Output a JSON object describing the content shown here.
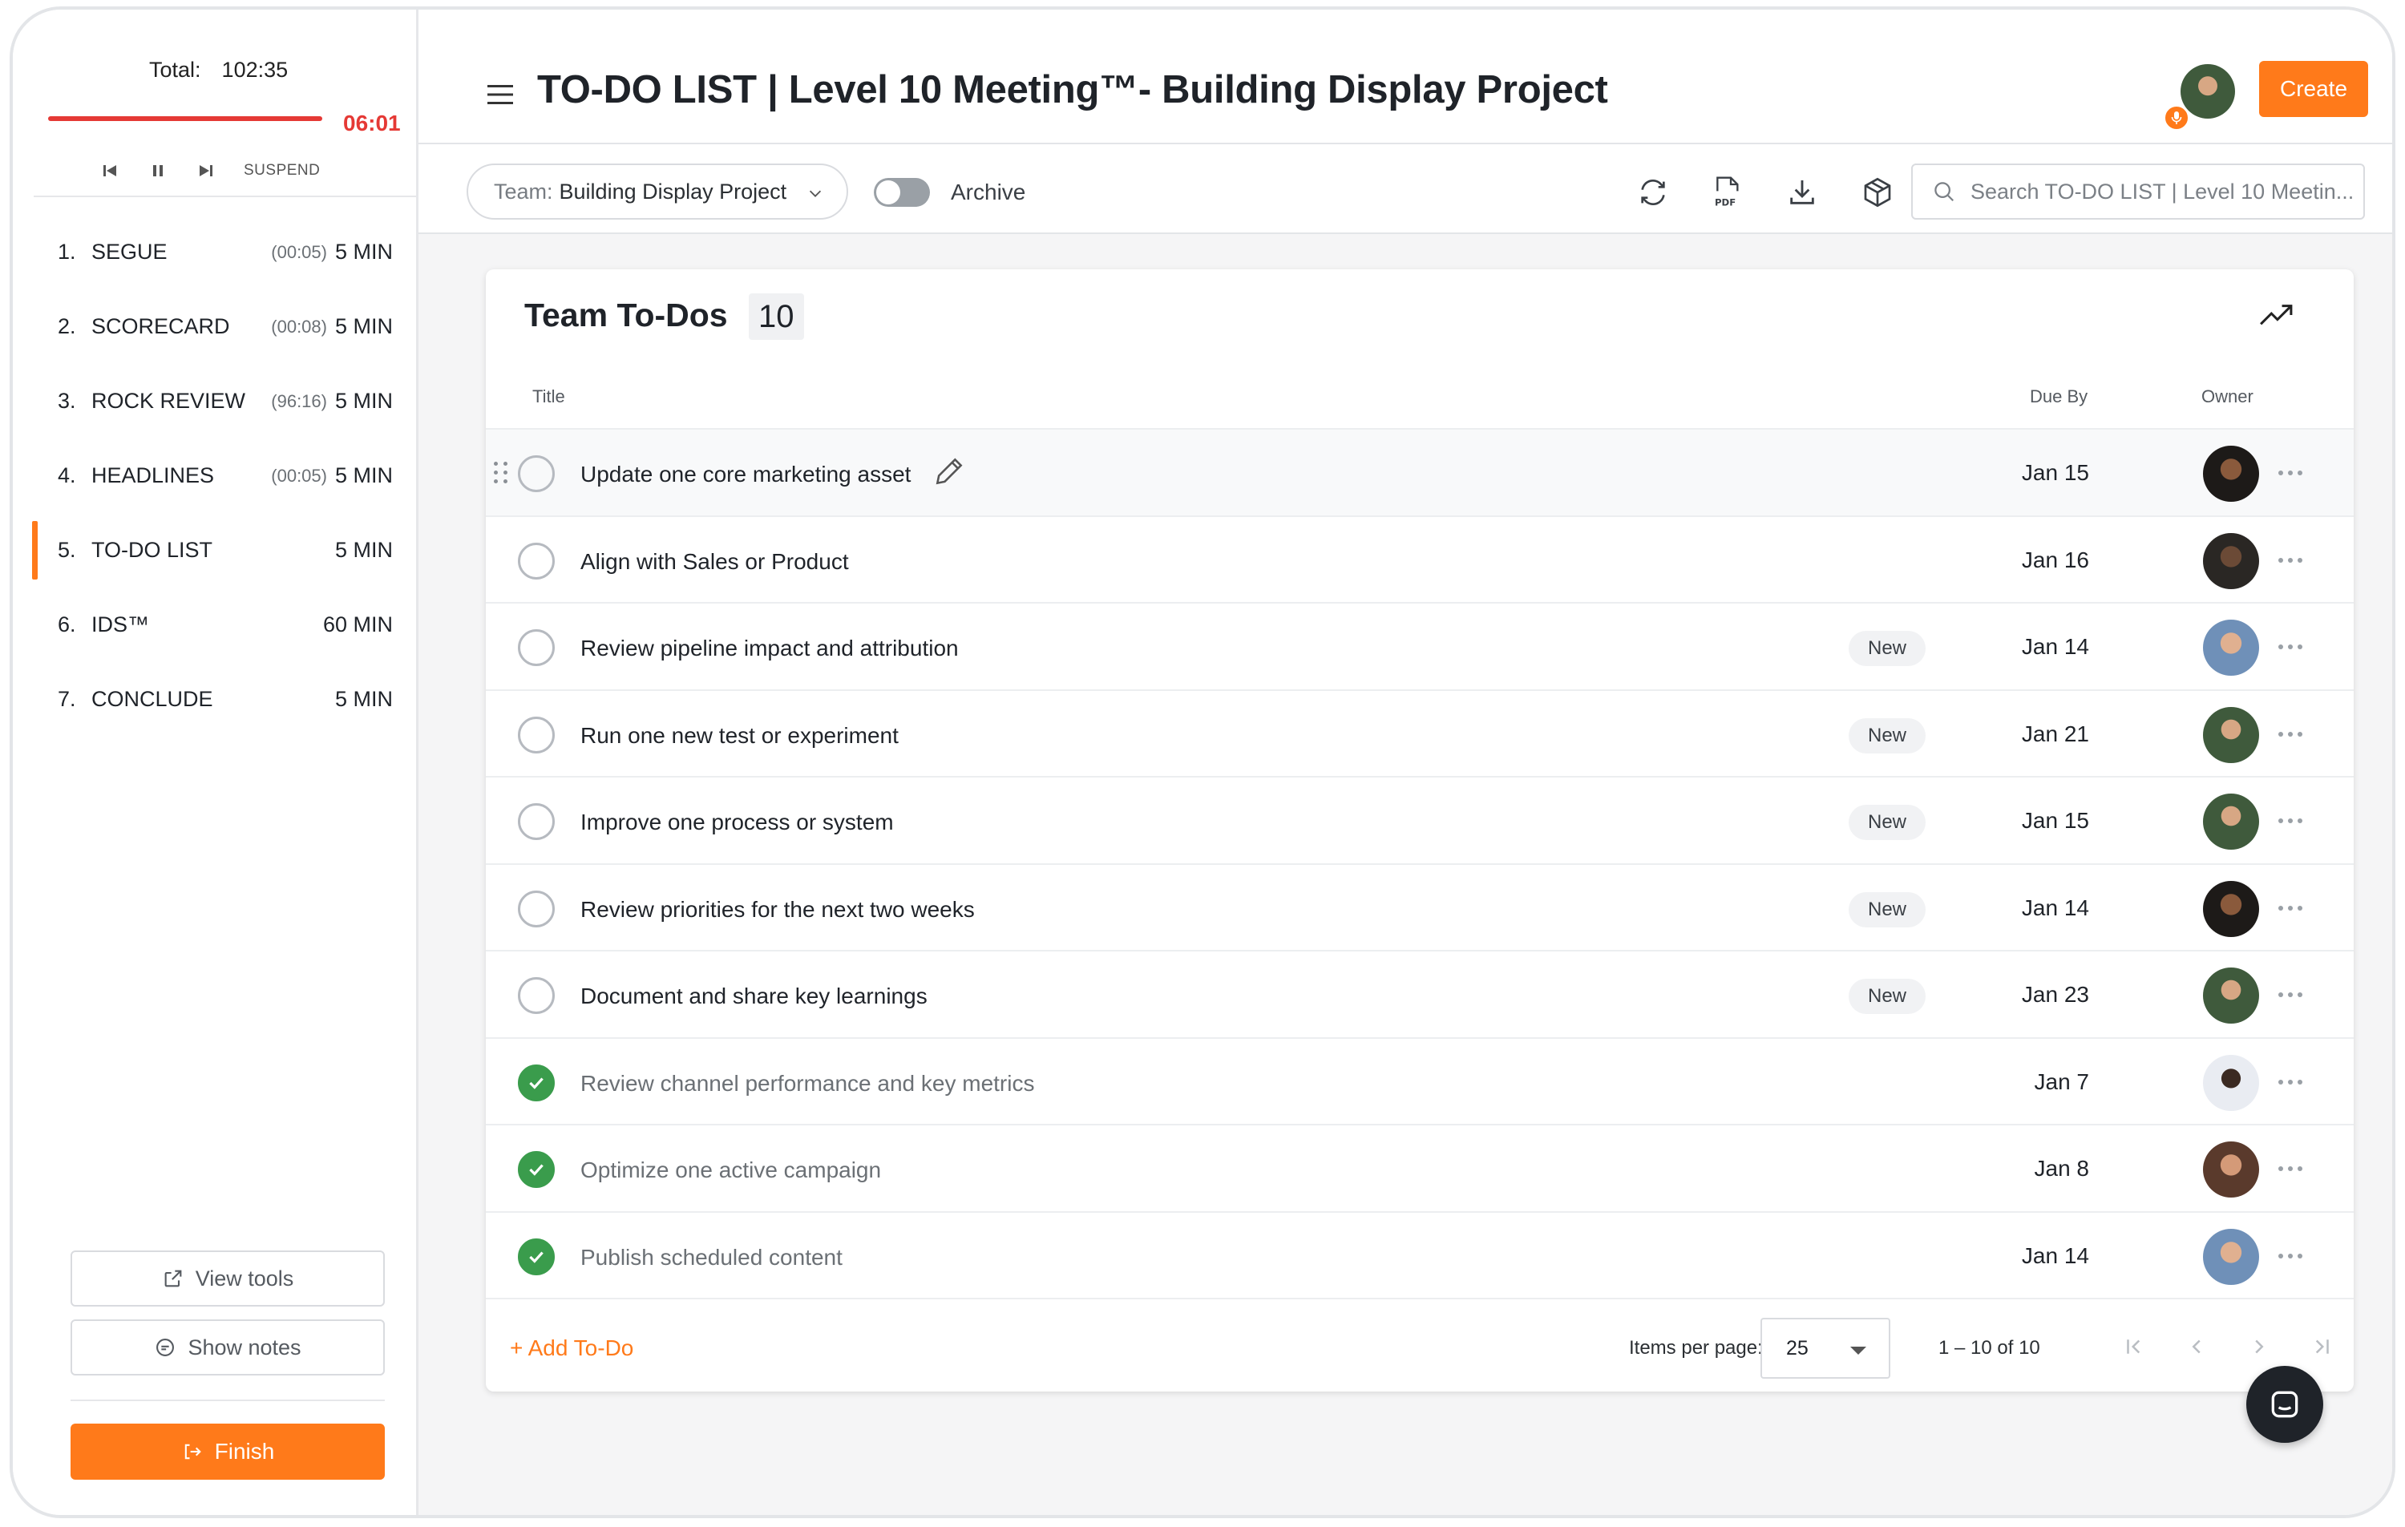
{
  "timer": {
    "total_label": "Total:",
    "total_value": "102:35",
    "remaining": "06:01",
    "suspend_label": "SUSPEND"
  },
  "agenda": [
    {
      "num": "1.",
      "name": "SEGUE",
      "elapsed": "(00:05)",
      "duration": "5 MIN",
      "active": false
    },
    {
      "num": "2.",
      "name": "SCORECARD",
      "elapsed": "(00:08)",
      "duration": "5 MIN",
      "active": false
    },
    {
      "num": "3.",
      "name": "ROCK REVIEW",
      "elapsed": "(96:16)",
      "duration": "5 MIN",
      "active": false
    },
    {
      "num": "4.",
      "name": "HEADLINES",
      "elapsed": "(00:05)",
      "duration": "5 MIN",
      "active": false
    },
    {
      "num": "5.",
      "name": "TO-DO LIST",
      "elapsed": "",
      "duration": "5 MIN",
      "active": true
    },
    {
      "num": "6.",
      "name": "IDS™",
      "elapsed": "",
      "duration": "60 MIN",
      "active": false
    },
    {
      "num": "7.",
      "name": "CONCLUDE",
      "elapsed": "",
      "duration": "5 MIN",
      "active": false
    }
  ],
  "sidebar_buttons": {
    "view_tools": "View tools",
    "show_notes": "Show notes",
    "finish": "Finish"
  },
  "header": {
    "title": "TO-DO LIST | Level 10 Meeting™- Building Display Project",
    "create_label": "Create"
  },
  "toolbar": {
    "team_prefix": "Team:",
    "team_value": "Building Display Project",
    "archive_label": "Archive",
    "archive_on": false,
    "search_placeholder": "Search TO-DO LIST | Level 10 Meetin..."
  },
  "card": {
    "title": "Team To-Dos",
    "count": "10",
    "columns": {
      "title": "Title",
      "due": "Due By",
      "owner": "Owner"
    },
    "new_label": "New",
    "todos": [
      {
        "title": "Update one core marketing asset",
        "due": "Jan 15",
        "done": false,
        "is_new": false
      },
      {
        "title": "Align with Sales or Product",
        "due": "Jan 16",
        "done": false,
        "is_new": false
      },
      {
        "title": "Review pipeline impact and attribution",
        "due": "Jan 14",
        "done": false,
        "is_new": true
      },
      {
        "title": "Run one new test or experiment",
        "due": "Jan 21",
        "done": false,
        "is_new": true
      },
      {
        "title": "Improve one process or system",
        "due": "Jan 15",
        "done": false,
        "is_new": true
      },
      {
        "title": "Review priorities for the next two weeks",
        "due": "Jan 14",
        "done": false,
        "is_new": true
      },
      {
        "title": "Document and share key learnings",
        "due": "Jan 23",
        "done": false,
        "is_new": true
      },
      {
        "title": "Review channel performance and key metrics",
        "due": "Jan 7",
        "done": true,
        "is_new": false
      },
      {
        "title": "Optimize one active campaign",
        "due": "Jan 8",
        "done": true,
        "is_new": false
      },
      {
        "title": "Publish scheduled content",
        "due": "Jan 14",
        "done": true,
        "is_new": false
      }
    ],
    "add_label": "+ Add To-Do",
    "items_per_page_label": "Items per page:",
    "items_per_page": "25",
    "range": "1 – 10 of 10"
  },
  "colors": {
    "accent": "#ff7a1a",
    "timer_red": "#e53935",
    "done_green": "#3a9c4c"
  }
}
